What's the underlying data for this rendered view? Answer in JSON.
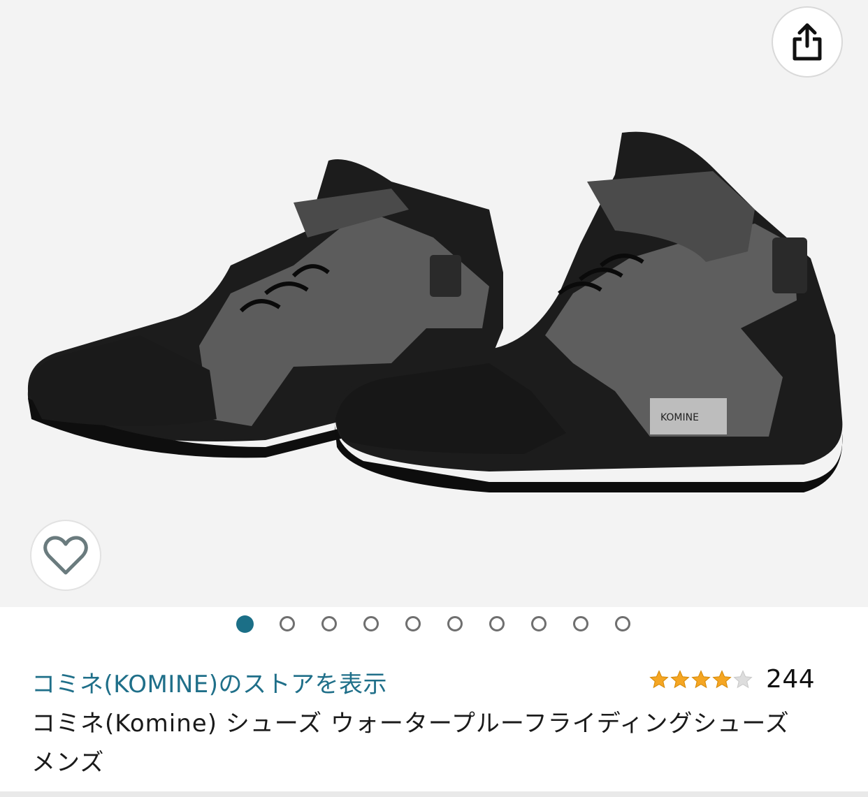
{
  "product_image": {
    "brand_tag": "KOMINE",
    "carousel_count": 10,
    "carousel_active_index": 0
  },
  "buttons": {
    "share_icon": "share-icon",
    "favorite_icon": "heart-icon"
  },
  "store": {
    "link_text": "コミネ(KOMINE)のストアを表示"
  },
  "rating": {
    "stars": 4,
    "max_stars": 5,
    "count": "244"
  },
  "product": {
    "title": "コミネ(Komine) シューズ ウォータープルーフライディングシューズ メンズ"
  },
  "colors": {
    "link": "#1f6f89",
    "active_dot": "#1b6f87",
    "star_filled": "#f5a623",
    "star_empty": "#d4d4d4"
  }
}
